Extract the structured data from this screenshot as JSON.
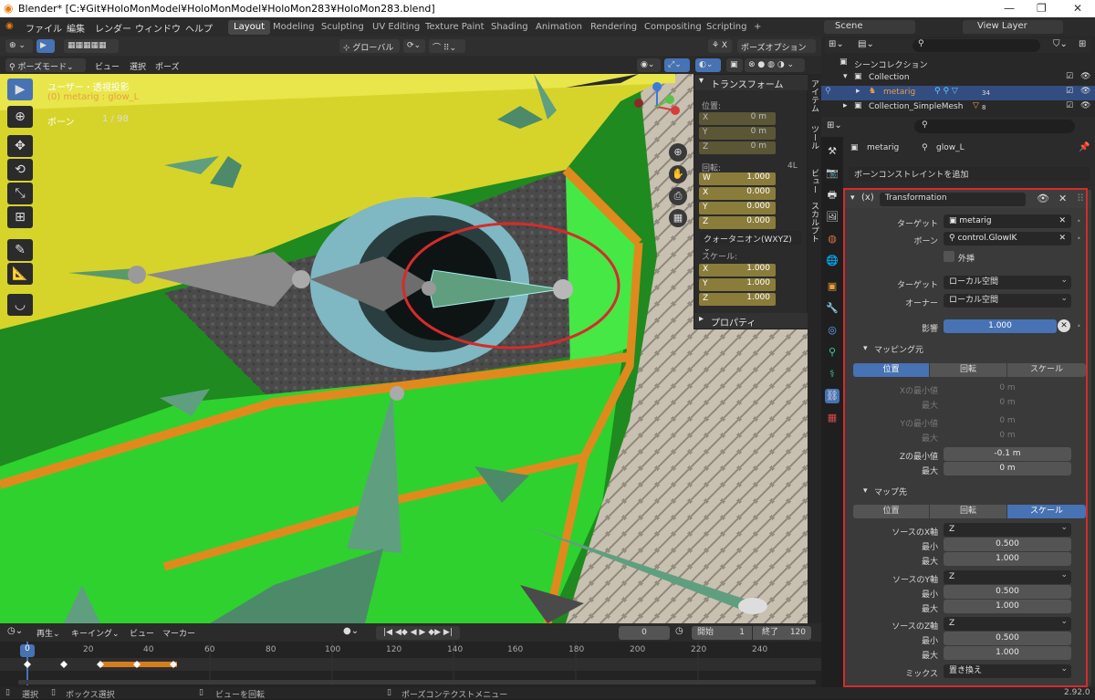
{
  "window": {
    "title": "Blender* [C:¥Git¥HoloMonModel¥HoloMonModel¥HoloMon283¥HoloMon283.blend]"
  },
  "menu": [
    "ファイル",
    "編集",
    "レンダー",
    "ウィンドウ",
    "ヘルプ"
  ],
  "workspaces": [
    "Layout",
    "Modeling",
    "Sculpting",
    "UV Editing",
    "Texture Paint",
    "Shading",
    "Animation",
    "Rendering",
    "Compositing",
    "Scripting"
  ],
  "scene": {
    "name": "Scene",
    "view_layer": "View Layer"
  },
  "header": {
    "transform": "グローバル",
    "pose_options": "ポーズオプション",
    "mode": "ポーズモード",
    "view": "ビュー",
    "select": "選択",
    "pose": "ポーズ"
  },
  "viewport": {
    "view_name": "ユーザー・透視投影",
    "object": "(0) metarig : glow_L",
    "bone_label": "ボーン",
    "bone_count": "1 / 98"
  },
  "npanel": {
    "transform_title": "トランスフォーム",
    "location_label": "位置:",
    "location": {
      "x": "0 m",
      "y": "0 m",
      "z": "0 m"
    },
    "rotation_label": "回転:",
    "rotation_mode_short": "4L",
    "rotation": {
      "w": "1.000",
      "x": "0.000",
      "y": "0.000",
      "z": "0.000"
    },
    "rotation_mode": "クォータニオン(WXYZ)",
    "scale_label": "スケール:",
    "scale": {
      "x": "1.000",
      "y": "1.000",
      "z": "1.000"
    },
    "properties_title": "プロパティ",
    "tabs": [
      "アイテム",
      "ツール",
      "ビュー",
      "スカルプト"
    ]
  },
  "outliner": {
    "scene_collection": "シーンコレクション",
    "collection": "Collection",
    "metarig": "metarig",
    "simple_mesh": "Collection_SimpleMesh",
    "badge1": "34",
    "badge2": "8"
  },
  "properties": {
    "object": "metarig",
    "bone": "glow_L",
    "add_constraint": "ボーンコンストレイントを追加",
    "constraint_name": "Transformation",
    "target_label": "ターゲット",
    "target": "metarig",
    "bone_label": "ボーン",
    "bone_target": "control.GlowIK",
    "extrapolate": "外挿",
    "target_space_label": "ターゲット",
    "target_space": "ローカル空間",
    "owner_space_label": "オーナー",
    "owner_space": "ローカル空間",
    "influence_label": "影響",
    "influence": "1.000",
    "map_from": "マッピング元",
    "map_from_tabs": [
      "位置",
      "回転",
      "スケール"
    ],
    "x_min_label": "Xの最小値",
    "x_min": "0 m",
    "x_max_label": "最大",
    "x_max": "0 m",
    "y_min_label": "Yの最小値",
    "y_min": "0 m",
    "y_max_label": "最大",
    "y_max": "0 m",
    "z_min_label": "Zの最小値",
    "z_min": "-0.1 m",
    "z_max_label": "最大",
    "z_max": "0 m",
    "map_to": "マップ先",
    "map_to_tabs": [
      "位置",
      "回転",
      "スケール"
    ],
    "src_x_label": "ソースのX軸",
    "src_x": "Z",
    "src_y_label": "ソースのY軸",
    "src_y": "Z",
    "src_z_label": "ソースのZ軸",
    "src_z": "Z",
    "min_label": "最小",
    "max_label": "最大",
    "sx_min": "0.500",
    "sx_max": "1.000",
    "sy_min": "0.500",
    "sy_max": "1.000",
    "sz_min": "0.500",
    "sz_max": "1.000",
    "mix_label": "ミックス",
    "mix": "置き換え"
  },
  "timeline": {
    "playback": "再生",
    "keying": "キーイング",
    "view": "ビュー",
    "marker": "マーカー",
    "current": "0",
    "start_label": "開始",
    "start": "1",
    "end_label": "終了",
    "end": "120",
    "ticks": [
      "0",
      "20",
      "40",
      "60",
      "80",
      "100",
      "120",
      "140",
      "160",
      "180",
      "200",
      "220",
      "240"
    ]
  },
  "status": {
    "select": "選択",
    "box": "ボックス選択",
    "rotate": "ビューを回転",
    "context": "ポーズコンテクストメニュー",
    "version": "2.92.0"
  },
  "colors": {
    "accent": "#4772b3",
    "highlight": "#d62b2b",
    "field_active": "#8a7c3a"
  }
}
